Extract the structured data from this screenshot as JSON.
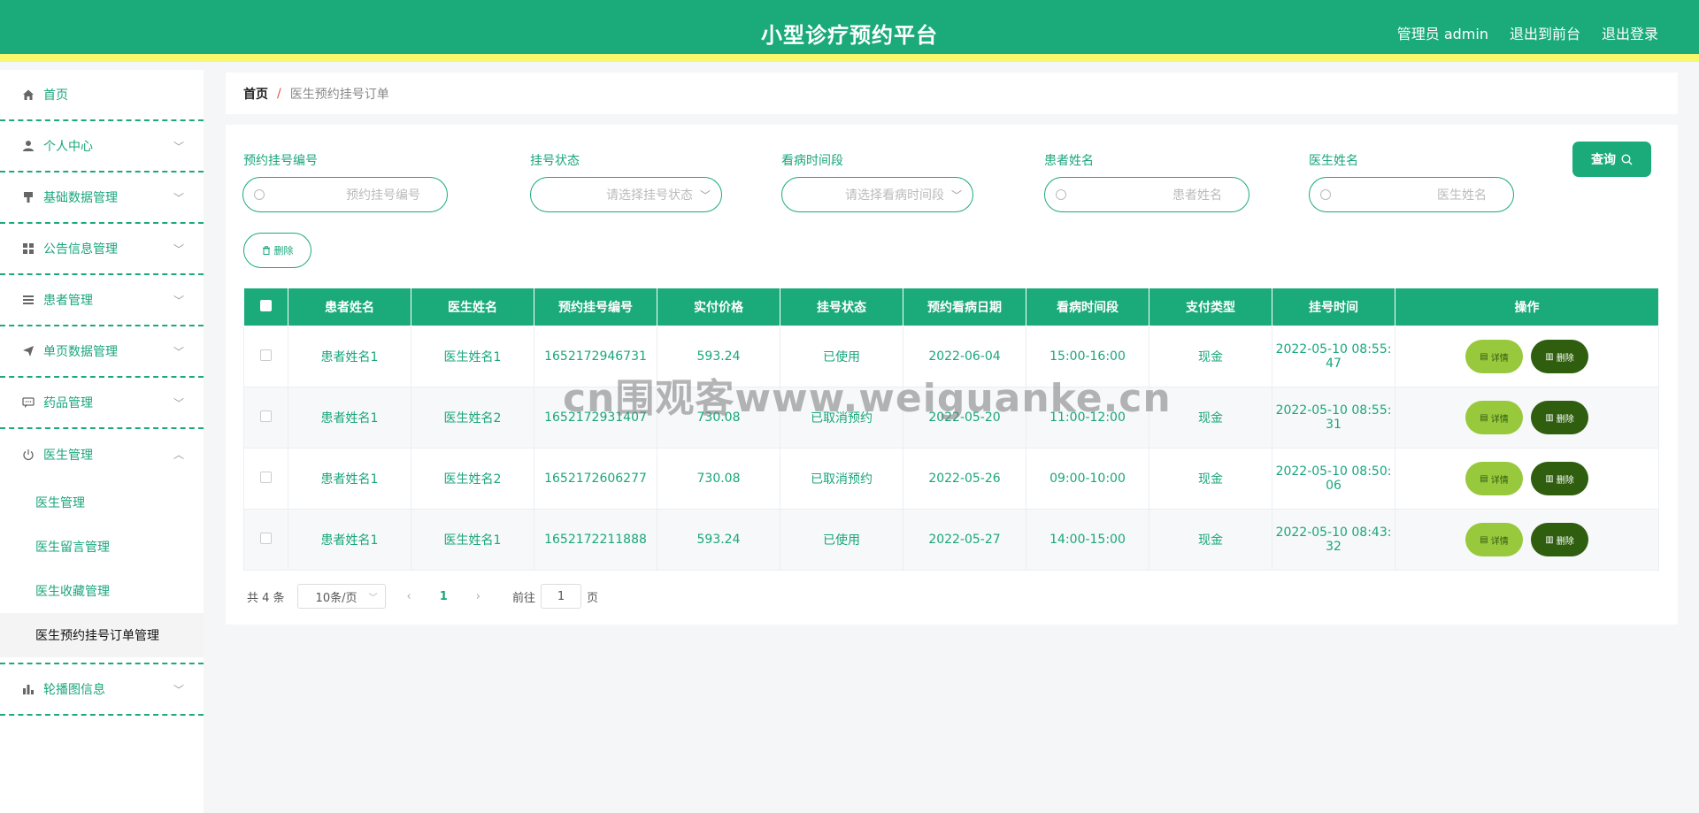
{
  "header": {
    "title": "小型诊疗预约平台",
    "admin": "管理员 admin",
    "to_front": "退出到前台",
    "logout": "退出登录"
  },
  "sidebar": {
    "items": [
      {
        "label": "首页",
        "icon": "home-icon"
      },
      {
        "label": "个人中心",
        "icon": "user-icon"
      },
      {
        "label": "基础数据管理",
        "icon": "brush-icon"
      },
      {
        "label": "公告信息管理",
        "icon": "grid-icon"
      },
      {
        "label": "患者管理",
        "icon": "list-icon"
      },
      {
        "label": "单页数据管理",
        "icon": "send-icon"
      },
      {
        "label": "药品管理",
        "icon": "chat-icon"
      },
      {
        "label": "医生管理",
        "icon": "power-icon"
      },
      {
        "label": "轮播图信息",
        "icon": "bar-chart-icon"
      }
    ],
    "doctor_sub": [
      "医生管理",
      "医生留言管理",
      "医生收藏管理",
      "医生预约挂号订单管理"
    ]
  },
  "breadcrumb": {
    "home": "首页",
    "sep": "/",
    "current": "医生预约挂号订单"
  },
  "filters": {
    "order_no": {
      "label": "预约挂号编号",
      "placeholder": "预约挂号编号"
    },
    "status": {
      "label": "挂号状态",
      "placeholder": "请选择挂号状态"
    },
    "period": {
      "label": "看病时间段",
      "placeholder": "请选择看病时间段"
    },
    "patient": {
      "label": "患者姓名",
      "placeholder": "患者姓名"
    },
    "doctor": {
      "label": "医生姓名",
      "placeholder": "医生姓名"
    },
    "query_label": "查询",
    "delete_label": "删除"
  },
  "table": {
    "headers": [
      "患者姓名",
      "医生姓名",
      "预约挂号编号",
      "实付价格",
      "挂号状态",
      "预约看病日期",
      "看病时间段",
      "支付类型",
      "挂号时间",
      "操作"
    ],
    "detail_label": "详情",
    "delete_label": "删除",
    "rows": [
      {
        "patient": "患者姓名1",
        "doctor": "医生姓名1",
        "no": "1652172946731",
        "price": "593.24",
        "status": "已使用",
        "date": "2022-06-04",
        "period": "15:00-16:00",
        "pay": "现金",
        "time1": "2022-05-10 08:55:",
        "time2": "47"
      },
      {
        "patient": "患者姓名1",
        "doctor": "医生姓名2",
        "no": "1652172931407",
        "price": "730.08",
        "status": "已取消预约",
        "date": "2022-05-20",
        "period": "11:00-12:00",
        "pay": "现金",
        "time1": "2022-05-10 08:55:",
        "time2": "31"
      },
      {
        "patient": "患者姓名1",
        "doctor": "医生姓名2",
        "no": "1652172606277",
        "price": "730.08",
        "status": "已取消预约",
        "date": "2022-05-26",
        "period": "09:00-10:00",
        "pay": "现金",
        "time1": "2022-05-10 08:50:",
        "time2": "06"
      },
      {
        "patient": "患者姓名1",
        "doctor": "医生姓名1",
        "no": "1652172211888",
        "price": "593.24",
        "status": "已使用",
        "date": "2022-05-27",
        "period": "14:00-15:00",
        "pay": "现金",
        "time1": "2022-05-10 08:43:",
        "time2": "32"
      }
    ]
  },
  "pager": {
    "total": "共 4 条",
    "size": "10条/页",
    "page": "1",
    "goto": "前往",
    "goto_value": "1",
    "page_unit": "页"
  },
  "watermark": "cn围观客www.weiguanke.cn",
  "colors": {
    "primary": "#1baa7a",
    "accent_bar": "#f7f86e",
    "detail_btn": "#98c93c",
    "delete_btn": "#2f5e0f"
  }
}
